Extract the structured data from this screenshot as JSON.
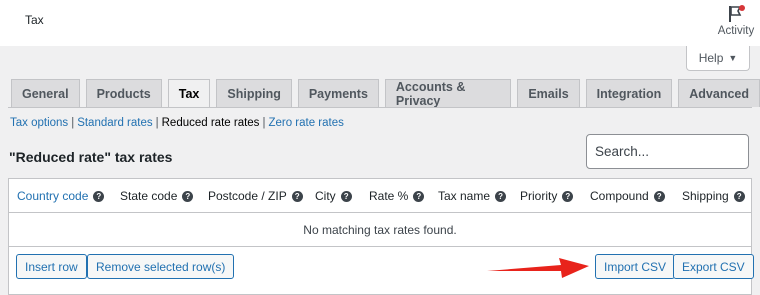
{
  "header": {
    "title": "Tax",
    "activity_label": "Activity"
  },
  "help": {
    "label": "Help"
  },
  "tabs": [
    {
      "label": "General"
    },
    {
      "label": "Products"
    },
    {
      "label": "Tax"
    },
    {
      "label": "Shipping"
    },
    {
      "label": "Payments"
    },
    {
      "label": "Accounts & Privacy"
    },
    {
      "label": "Emails"
    },
    {
      "label": "Integration"
    },
    {
      "label": "Advanced"
    }
  ],
  "active_tab": "Tax",
  "subsections": {
    "tax_options": "Tax options",
    "standard_rates": "Standard rates",
    "reduced_rate_rates": "Reduced rate rates",
    "zero_rate_rates": "Zero rate rates",
    "separator": "|"
  },
  "page_heading": "\"Reduced rate\" tax rates",
  "search": {
    "placeholder": "Search..."
  },
  "table": {
    "columns": [
      {
        "label": "Country code"
      },
      {
        "label": "State code"
      },
      {
        "label": "Postcode / ZIP"
      },
      {
        "label": "City"
      },
      {
        "label": "Rate %"
      },
      {
        "label": "Tax name"
      },
      {
        "label": "Priority"
      },
      {
        "label": "Compound"
      },
      {
        "label": "Shipping"
      }
    ],
    "help_glyph": "?",
    "empty_message": "No matching tax rates found."
  },
  "actions": {
    "insert_row": "Insert row",
    "remove_selected": "Remove selected row(s)",
    "import_csv": "Import CSV",
    "export_csv": "Export CSV"
  },
  "colors": {
    "link": "#2271b1",
    "annotation_arrow": "#e8231b",
    "notification_dot": "#d63638"
  }
}
